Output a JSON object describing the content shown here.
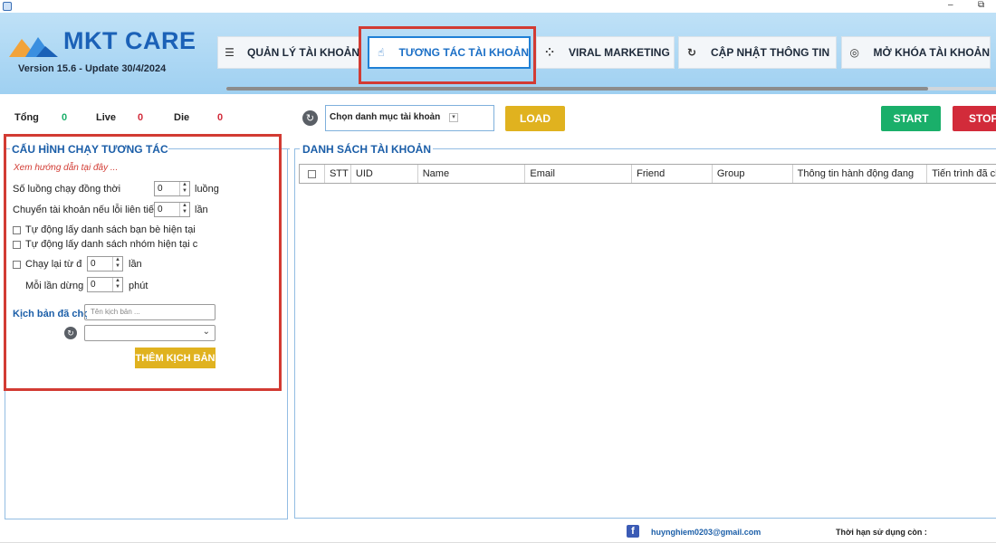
{
  "window": {
    "minimize": "–",
    "restore": "⧉"
  },
  "app": {
    "brand": "MKT CARE",
    "version_line": "Version  15.6   - Update  30/4/2024"
  },
  "tabs": [
    {
      "label": "QUẢN LÝ TÀI KHOẢN",
      "icon": "list-icon",
      "glyph": "☰"
    },
    {
      "label": "TƯƠNG TÁC TÀI KHOẢN",
      "icon": "hand-pointer-icon",
      "glyph": "☝",
      "active": true
    },
    {
      "label": "VIRAL MARKETING",
      "icon": "grid-apps-icon",
      "glyph": "⁘"
    },
    {
      "label": "CẬP NHẬT THÔNG TIN",
      "icon": "refresh-user-icon",
      "glyph": "↻"
    },
    {
      "label": "MỞ KHÓA TÀI KHOẢN",
      "icon": "fingerprint-icon",
      "glyph": "◎"
    }
  ],
  "stats": {
    "total_label": "Tổng",
    "total_value": "0",
    "live_label": "Live",
    "live_value": "0",
    "die_label": "Die",
    "die_value": "0",
    "colors": {
      "total": "#1aaf6a",
      "live": "#d22b3a",
      "die": "#d22b3a"
    }
  },
  "toolbar": {
    "category_select": "Chọn danh mục tài khoản",
    "load": "LOAD",
    "start": "START",
    "stop": "STOP"
  },
  "config": {
    "title": "CẤU HÌNH CHẠY TƯƠNG TÁC",
    "guide_link": "Xem hướng dẫn tại đây ...",
    "threads_label": "Số luồng chạy đồng thời",
    "threads_value": "0",
    "threads_unit": "luồng",
    "switch_label": "Chuyển tài khoản nếu lỗi liên tiếp",
    "switch_value": "0",
    "switch_unit": "lần",
    "auto_friends": "Tự động lấy danh sách bạn bè hiện tại của",
    "auto_groups": "Tự động lấy danh sách nhóm hiện tại của",
    "rerun_label": "Chạy lại từ đầu",
    "rerun_value": "0",
    "rerun_unit": "lần",
    "pause_label": "Mỗi lần dừng",
    "pause_value": "0",
    "pause_unit": "phút",
    "scripts_label": "Kịch bản đã chọn",
    "script_name_placeholder": "Tên kịch bản ...",
    "add_script": "THÊM KỊCH BẢN"
  },
  "accounts": {
    "title": "DANH SÁCH TÀI KHOẢN",
    "columns": [
      "STT",
      "UID",
      "Name",
      "Email",
      "Friend",
      "Group",
      "Thông tin hành động đang",
      "Tiến trình đã chạy"
    ]
  },
  "footer": {
    "email": "huynghiem0203@gmail.com",
    "expiry_label": "Thời hạn sử dụng còn :"
  }
}
